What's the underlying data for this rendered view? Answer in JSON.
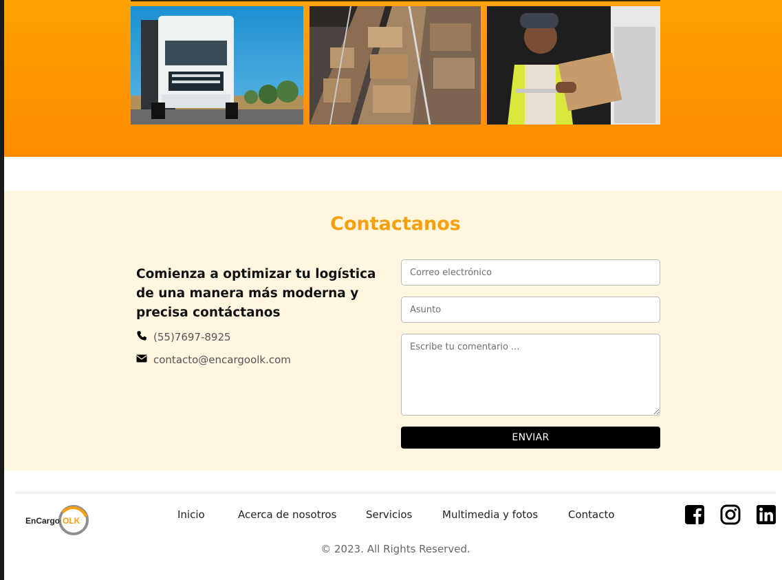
{
  "gallery": {
    "images": [
      {
        "name": "truck-photo"
      },
      {
        "name": "warehouse-photo"
      },
      {
        "name": "worker-photo"
      }
    ]
  },
  "contact": {
    "title": "Contactanos",
    "heading": "Comienza a optimizar tu logística de una manera más moderna y precisa contáctanos",
    "phone": "(55)7697-8925",
    "email": "contacto@encargoolk.com",
    "form": {
      "email_placeholder": "Correo electrónico",
      "subject_placeholder": "Asunto",
      "comment_placeholder": "Escribe tu comentario ...",
      "submit_label": "ENVIAR"
    }
  },
  "footer": {
    "logo_text_main": "EnCargo",
    "logo_text_accent": "OLK",
    "nav": [
      "Inicio",
      "Acerca de nosotros",
      "Servicios",
      "Multimedia y fotos",
      "Contacto"
    ],
    "social": [
      "facebook-icon",
      "instagram-icon",
      "linkedin-icon"
    ],
    "copyright": "© 2023. All Rights Reserved."
  },
  "colors": {
    "accent_orange": "#f5a00e",
    "band_orange": "#ff8c00",
    "contact_bg": "#fff6e0",
    "button_bg": "#000000"
  }
}
